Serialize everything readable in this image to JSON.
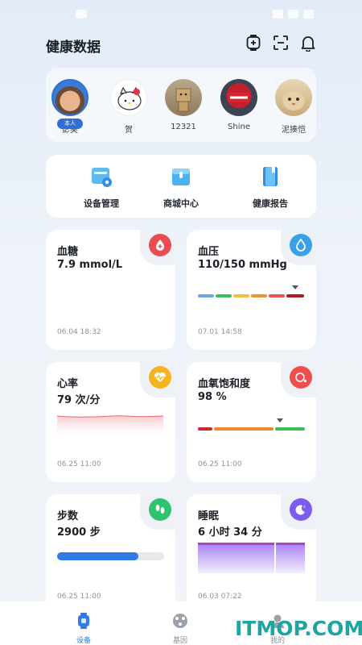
{
  "header": {
    "title": "健康数据"
  },
  "family": {
    "self_badge": "本人",
    "members": [
      {
        "name": "彭昊",
        "avatar": "cartoon-boy-avatar"
      },
      {
        "name": "贺",
        "avatar": "hello-kitty-avatar"
      },
      {
        "name": "12321",
        "avatar": "box-figure-avatar"
      },
      {
        "name": "Shine",
        "avatar": "red-text-avatar"
      },
      {
        "name": "泥揍恺",
        "avatar": "cat-avatar"
      }
    ]
  },
  "quick": {
    "device": "设备管理",
    "mall": "商城中心",
    "report": "健康报告"
  },
  "cards": {
    "glucose": {
      "title": "血糖",
      "value": "7.9 mmol/L",
      "time": "06.04 18:32",
      "color": "#e94d52"
    },
    "pressure": {
      "title": "血压",
      "value": "110/150 mmHg",
      "time": "07.01 14:58",
      "color": "#3aa1e8"
    },
    "heart": {
      "title": "心率",
      "value": "79 次/分",
      "time": "06.25 11:00",
      "color": "#f5b41c"
    },
    "oxygen": {
      "title": "血氧饱和度",
      "value": "98 %",
      "time": "06.25 11:00",
      "color": "#ef4e4e"
    },
    "steps": {
      "title": "步数",
      "value": "2900 步",
      "time": "06.25 11:00",
      "progress": 0.76,
      "color": "#2ec46d"
    },
    "sleep": {
      "title": "睡眠",
      "value": "6 小时 34 分",
      "time": "06.03 07:22",
      "color": "#7b5cf0"
    }
  },
  "tabs": {
    "device": "设备",
    "gene": "基因",
    "mine": "我的"
  },
  "watermark": "ITMOP.COM"
}
